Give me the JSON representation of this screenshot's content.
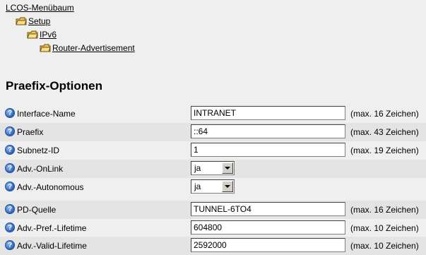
{
  "breadcrumb": {
    "root": "LCOS-Menübaum",
    "level1": "Setup",
    "level2": "IPv6",
    "level3": "Router-Advertisement"
  },
  "section_title": "Praefix-Optionen",
  "fields": {
    "interface_name": {
      "label": "Interface-Name",
      "value": "INTRANET",
      "hint": "(max. 16 Zeichen)"
    },
    "praefix": {
      "label": "Praefix",
      "value": "::64",
      "hint": "(max. 43 Zeichen)"
    },
    "subnetz_id": {
      "label": "Subnetz-ID",
      "value": "1",
      "hint": "(max. 19 Zeichen)"
    },
    "adv_onlink": {
      "label": "Adv.-OnLink",
      "value": "ja"
    },
    "adv_autonomous": {
      "label": "Adv.-Autonomous",
      "value": "ja"
    },
    "pd_quelle": {
      "label": "PD-Quelle",
      "value": "TUNNEL-6TO4",
      "hint": "(max. 16 Zeichen)"
    },
    "adv_pref_lifetime": {
      "label": "Adv.-Pref.-Lifetime",
      "value": "604800",
      "hint": "(max. 10 Zeichen)"
    },
    "adv_valid_lifetime": {
      "label": "Adv.-Valid-Lifetime",
      "value": "2592000",
      "hint": "(max. 10 Zeichen)"
    }
  },
  "icons": {
    "help": "help-icon",
    "folder": "folder-icon"
  },
  "colors": {
    "background": "#efefef",
    "row_alt": "#e4e4e4",
    "help_blue": "#2d64b8"
  }
}
